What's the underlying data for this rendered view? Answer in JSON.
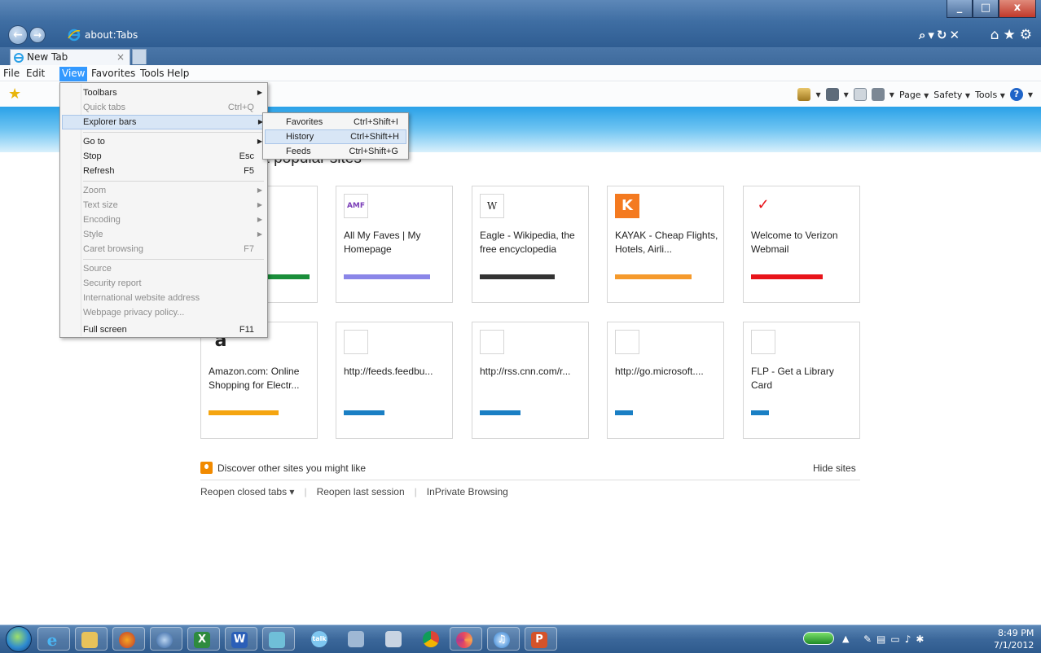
{
  "window": {
    "minimize": "_",
    "maximize": "□",
    "close": "x"
  },
  "address": {
    "url": "about:Tabs",
    "tools": "⌕▾↻✕"
  },
  "tab": {
    "title": "New Tab",
    "close": "×"
  },
  "menubar": [
    "File",
    "Edit",
    "View",
    "Favorites",
    "Tools",
    "Help"
  ],
  "commandbar": {
    "page": "Page",
    "safety": "Safety",
    "tools": "Tools"
  },
  "page": {
    "heading": "Your most popular sites",
    "tiles_row1": [
      {
        "label": "",
        "icon_text": "",
        "bar_color": "#1a8e3a",
        "bar_width": 124
      },
      {
        "label": "All My Faves | My Homepage",
        "icon_text": "AMF",
        "bar_color": "#8a86e8",
        "bar_width": 106
      },
      {
        "label": "Eagle - Wikipedia, the free encyclopedia",
        "icon_text": "W",
        "bar_color": "#333333",
        "bar_width": 92
      },
      {
        "label": "KAYAK - Cheap Flights, Hotels, Airli...",
        "icon_text": "K",
        "bar_color": "#f59a2c",
        "bar_width": 94
      },
      {
        "label": "Welcome to Verizon Webmail",
        "icon_text": "✓",
        "bar_color": "#e8141a",
        "bar_width": 88
      }
    ],
    "tiles_row2": [
      {
        "label": "Amazon.com: Online Shopping for Electr...",
        "icon_text": "a",
        "bar_color": "#f5a510",
        "bar_width": 86
      },
      {
        "label": "http://feeds.feedbu...",
        "icon_text": "",
        "bar_color": "#1a7fc4",
        "bar_width": 50
      },
      {
        "label": "http://rss.cnn.com/r...",
        "icon_text": "",
        "bar_color": "#1a7fc4",
        "bar_width": 50
      },
      {
        "label": "http://go.microsoft....",
        "icon_text": "",
        "bar_color": "#1a7fc4",
        "bar_width": 22
      },
      {
        "label": "FLP - Get a Library Card",
        "icon_text": "",
        "bar_color": "#1a7fc4",
        "bar_width": 22
      }
    ],
    "discover": "Discover other sites you might like",
    "hide_sites": "Hide sites",
    "footer_links": [
      "Reopen closed tabs ▾",
      "|",
      "Reopen last session",
      "|",
      "InPrivate Browsing"
    ]
  },
  "view_menu": [
    {
      "label": "Toolbars",
      "shortcut": "",
      "submenu": true,
      "disabled": false
    },
    {
      "label": "Quick tabs",
      "shortcut": "Ctrl+Q",
      "submenu": false,
      "disabled": true
    },
    {
      "label": "Explorer bars",
      "shortcut": "",
      "submenu": true,
      "disabled": false,
      "highlight": true
    },
    {
      "label": "Go to",
      "shortcut": "",
      "submenu": true,
      "disabled": false
    },
    {
      "label": "Stop",
      "shortcut": "Esc",
      "submenu": false,
      "disabled": false
    },
    {
      "label": "Refresh",
      "shortcut": "F5",
      "submenu": false,
      "disabled": false
    },
    {
      "label": "Zoom",
      "shortcut": "",
      "submenu": true,
      "disabled": true
    },
    {
      "label": "Text size",
      "shortcut": "",
      "submenu": true,
      "disabled": true
    },
    {
      "label": "Encoding",
      "shortcut": "",
      "submenu": true,
      "disabled": true
    },
    {
      "label": "Style",
      "shortcut": "",
      "submenu": true,
      "disabled": true
    },
    {
      "label": "Caret browsing",
      "shortcut": "F7",
      "submenu": false,
      "disabled": true
    },
    {
      "label": "Source",
      "shortcut": "",
      "submenu": false,
      "disabled": true
    },
    {
      "label": "Security report",
      "shortcut": "",
      "submenu": false,
      "disabled": true
    },
    {
      "label": "International website address",
      "shortcut": "",
      "submenu": false,
      "disabled": true
    },
    {
      "label": "Webpage privacy policy...",
      "shortcut": "",
      "submenu": false,
      "disabled": true
    },
    {
      "label": "Full screen",
      "shortcut": "F11",
      "submenu": false,
      "disabled": false
    }
  ],
  "explorer_submenu": [
    {
      "label": "Favorites",
      "shortcut": "Ctrl+Shift+I"
    },
    {
      "label": "History",
      "shortcut": "Ctrl+Shift+H",
      "highlight": true
    },
    {
      "label": "Feeds",
      "shortcut": "Ctrl+Shift+G"
    }
  ],
  "taskbar": {
    "apps": [
      "internet-explorer",
      "file-explorer",
      "firefox",
      "thunderbird",
      "excel",
      "word",
      "shared-folder",
      "google-talk",
      "teamviewer",
      "snipping-tool",
      "chrome",
      "pinwheel",
      "itunes",
      "powerpoint"
    ],
    "time": "8:49 PM",
    "date": "7/1/2012"
  }
}
